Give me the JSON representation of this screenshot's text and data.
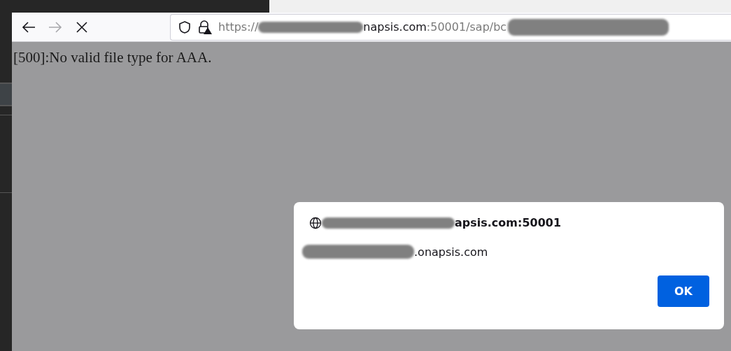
{
  "toolbar": {
    "nav_buttons": [
      {
        "kind": "back",
        "disabled": false
      },
      {
        "kind": "forward",
        "disabled": true
      },
      {
        "kind": "stop",
        "disabled": false
      }
    ],
    "address": {
      "scheme": "https://",
      "domain_end": "napsis.com",
      "rest": ":50001/sap/bc"
    }
  },
  "page": {
    "text": "[500]:No valid file type for AAA."
  },
  "dialog": {
    "origin": "apsis.com:50001",
    "message": ".onapsis.com",
    "button": "OK"
  }
}
